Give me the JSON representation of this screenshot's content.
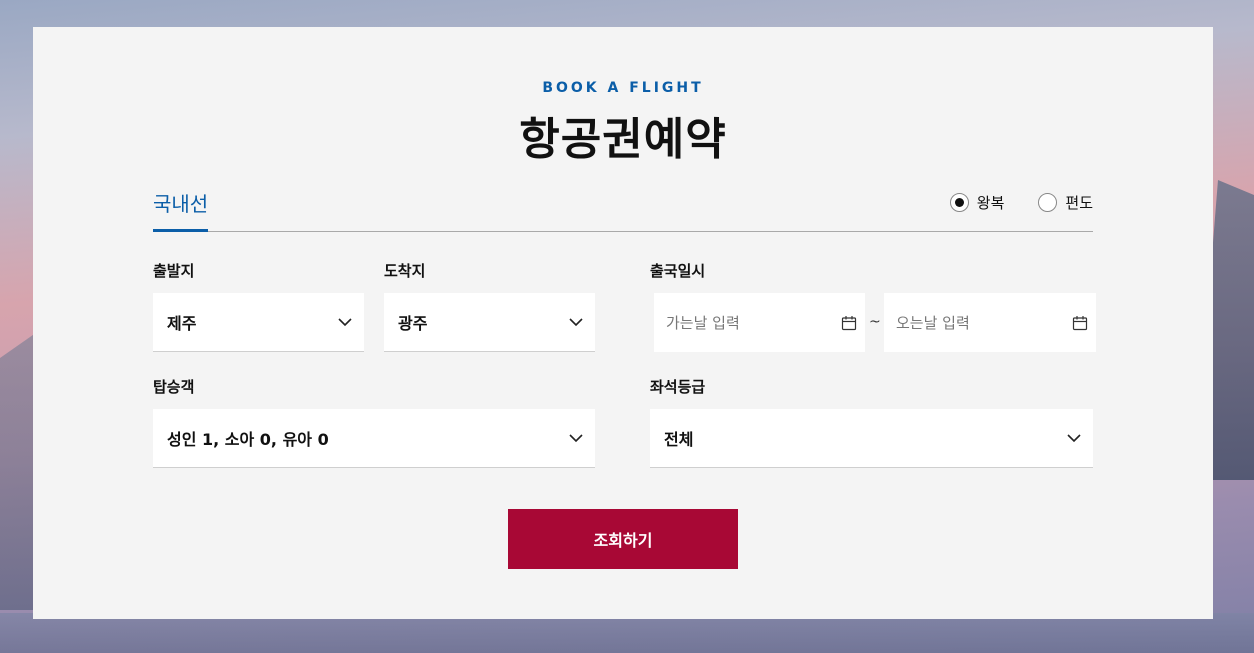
{
  "header": {
    "eyebrow": "BOOK A FLIGHT",
    "title": "항공권예약"
  },
  "tabs": [
    {
      "label": "국내선",
      "active": true
    }
  ],
  "trip_type": {
    "options": [
      {
        "label": "왕복",
        "checked": true
      },
      {
        "label": "편도",
        "checked": false
      }
    ]
  },
  "form": {
    "origin": {
      "label": "출발지",
      "value": "제주"
    },
    "destination": {
      "label": "도착지",
      "value": "광주"
    },
    "dates": {
      "label": "출국일시",
      "depart_placeholder": "가는날 입력",
      "return_placeholder": "오는날 입력",
      "separator": "~"
    },
    "passengers": {
      "label": "탑승객",
      "value": "성인 1, 소아 0, 유아 0"
    },
    "seat_class": {
      "label": "좌석등급",
      "value": "전체"
    }
  },
  "actions": {
    "search_label": "조회하기"
  },
  "colors": {
    "accent_blue": "#0b5ea8",
    "submit_red": "#a80835",
    "panel_bg": "#f4f4f4"
  },
  "icons": [
    "chevron-down-icon",
    "calendar-icon",
    "radio-icon"
  ]
}
